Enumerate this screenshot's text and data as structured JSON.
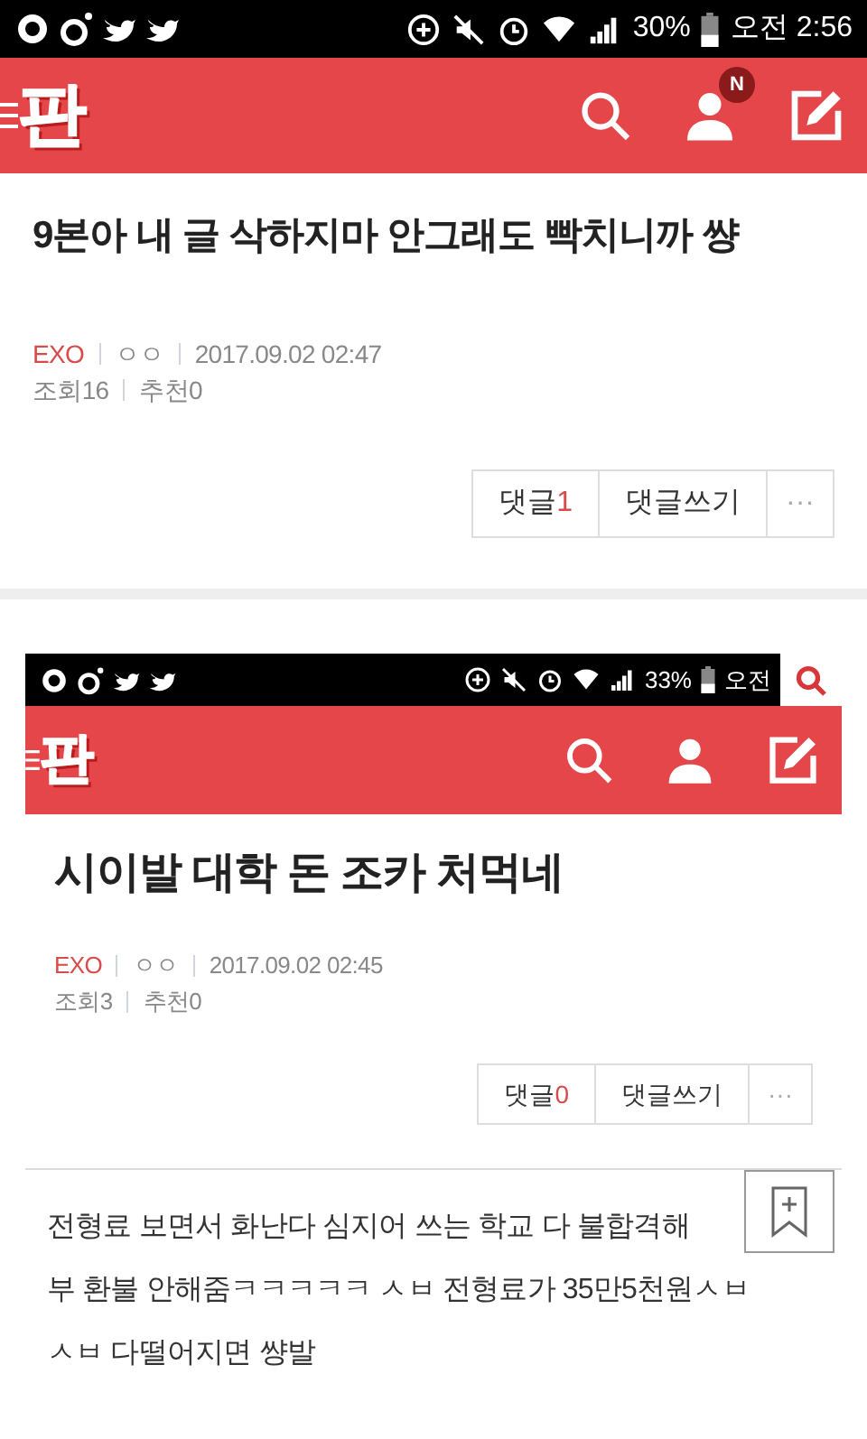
{
  "status_bar": {
    "battery": "30%",
    "time": "오전 2:56"
  },
  "app_bar": {
    "logo": "판",
    "notification_badge": "N"
  },
  "post": {
    "title": "9본아 내 글 삭하지마 안그래도 빡치니까 썅",
    "board": "EXO",
    "author": "ㅇㅇ",
    "date": "2017.09.02 02:47",
    "views_label": "조회",
    "views": "16",
    "likes_label": "추천",
    "likes": "0",
    "comments_label": "댓글",
    "comments": "1",
    "write_comment": "댓글쓰기",
    "more": "···"
  },
  "embedded_screenshot": {
    "status_bar": {
      "battery": "33%",
      "time": "오전"
    },
    "app_bar": {
      "logo": "판"
    },
    "post": {
      "title": "시이발 대학 돈 조카 처먹네",
      "board": "EXO",
      "author": "ㅇㅇ",
      "date": "2017.09.02 02:45",
      "views_label": "조회",
      "views": "3",
      "likes_label": "추천",
      "likes": "0",
      "comments_label": "댓글",
      "comments": "0",
      "write_comment": "댓글쓰기",
      "more": "···"
    },
    "body_lines": [
      "전형료 보면서 화난다 심지어 쓰는 학교 다 불합격해",
      "부 환불 안해줌ㅋㅋㅋㅋㅋ ㅅㅂ 전형료가 35만5천원ㅅㅂ",
      "ㅅㅂ 다떨어지면 썅발"
    ]
  }
}
